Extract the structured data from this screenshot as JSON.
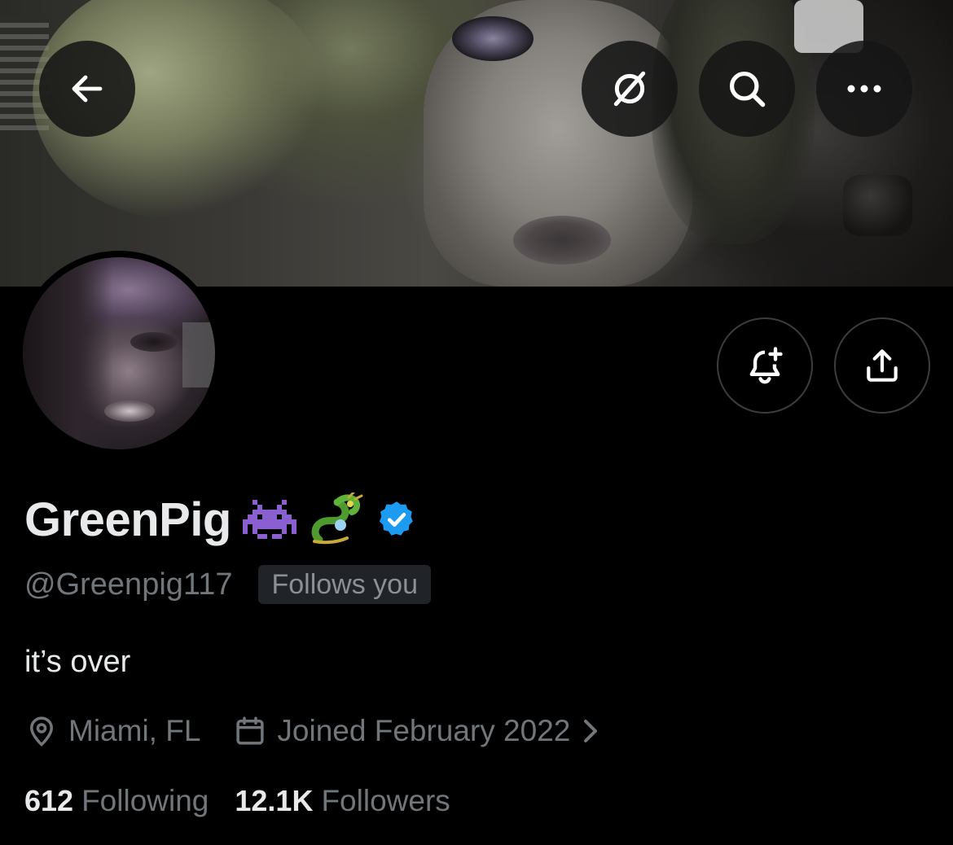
{
  "header": {
    "back_icon": "arrow-left-icon",
    "grok_icon": "grok-icon",
    "search_icon": "search-icon",
    "more_icon": "more-horizontal-icon"
  },
  "actions": {
    "notify_icon": "bell-plus-icon",
    "share_icon": "share-upload-icon"
  },
  "profile": {
    "display_name": "GreenPig",
    "name_emojis": [
      "👾",
      "🐉"
    ],
    "verified": true,
    "verified_color": "#1d9bf0",
    "handle": "@Greenpig117",
    "follows_you_label": "Follows you",
    "bio": "it’s over",
    "location": "Miami, FL",
    "joined": "Joined February 2022",
    "following_count": "612",
    "following_label": "Following",
    "followers_count": "12.1K",
    "followers_label": "Followers"
  }
}
